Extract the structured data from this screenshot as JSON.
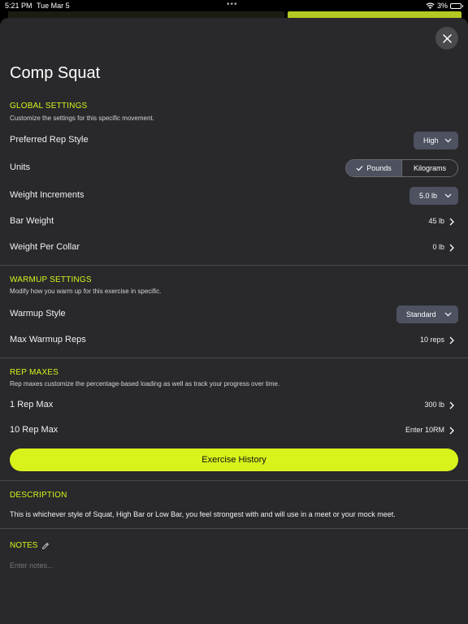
{
  "status_bar": {
    "time": "5:21 PM",
    "date": "Tue Mar 5",
    "battery": "3%"
  },
  "page": {
    "title": "Comp Squat",
    "close_icon": "close-icon"
  },
  "global_settings": {
    "heading": "GLOBAL SETTINGS",
    "subtitle": "Customize the settings for this specific movement.",
    "preferred_rep_style": {
      "label": "Preferred Rep Style",
      "value": "High"
    },
    "units": {
      "label": "Units",
      "options": [
        "Pounds",
        "Kilograms"
      ],
      "selected": "Pounds"
    },
    "weight_increments": {
      "label": "Weight Increments",
      "value": "5.0 lb"
    },
    "bar_weight": {
      "label": "Bar Weight",
      "value": "45 lb"
    },
    "weight_per_collar": {
      "label": "Weight Per Collar",
      "value": "0 lb"
    }
  },
  "warmup_settings": {
    "heading": "WARMUP SETTINGS",
    "subtitle": "Modify how you warm up for this exercise in specific.",
    "warmup_style": {
      "label": "Warmup Style",
      "value": "Standard"
    },
    "max_warmup_reps": {
      "label": "Max Warmup Reps",
      "value": "10 reps"
    }
  },
  "rep_maxes": {
    "heading": "REP MAXES",
    "subtitle": "Rep maxes customize the percentage-based loading as well as track your progress over time.",
    "one_rep_max": {
      "label": "1 Rep Max",
      "value": "300 lb"
    },
    "ten_rep_max": {
      "label": "10 Rep Max",
      "value": "Enter 10RM"
    }
  },
  "exercise_history": {
    "label": "Exercise History"
  },
  "description": {
    "heading": "DESCRIPTION",
    "text": "This is whichever style of Squat, High Bar or Low Bar, you feel strongest with and will use in a meet or your mock meet."
  },
  "notes": {
    "heading": "NOTES",
    "placeholder": "Enter notes..."
  },
  "colors": {
    "accent": "#d8f31b",
    "sheet_background": "#29292c",
    "pill_background": "#4d5160"
  }
}
